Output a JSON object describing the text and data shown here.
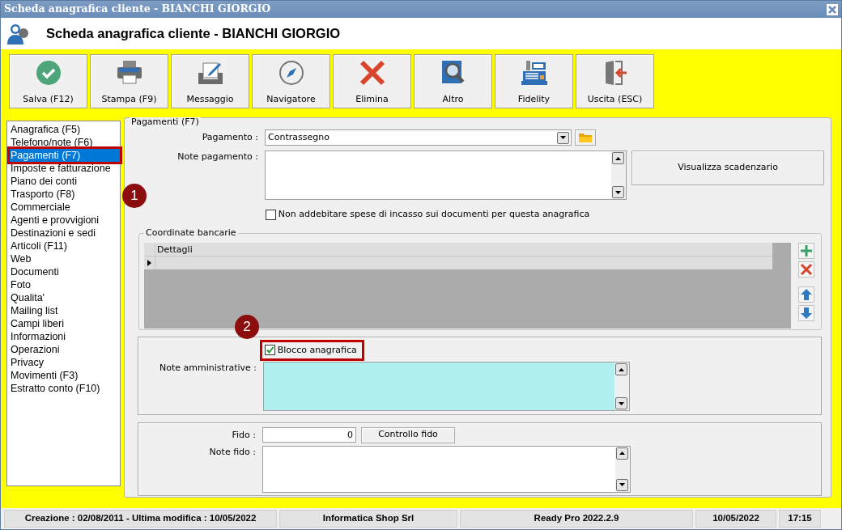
{
  "window": {
    "title": "Scheda anagrafica cliente - BIANCHI GIORGIO"
  },
  "header": {
    "title": "Scheda anagrafica cliente - BIANCHI GIORGIO"
  },
  "toolbar": [
    {
      "label": "Salva (F12)",
      "kind": "save"
    },
    {
      "label": "Stampa (F9)",
      "kind": "print"
    },
    {
      "label": "Messaggio",
      "kind": "message"
    },
    {
      "label": "Navigatore",
      "kind": "compass"
    },
    {
      "label": "Elimina",
      "kind": "delete"
    },
    {
      "label": "Altro",
      "kind": "search"
    },
    {
      "label": "Fidelity",
      "kind": "register"
    },
    {
      "label": "Uscita (ESC)",
      "kind": "exit"
    }
  ],
  "sidebar": {
    "items": [
      {
        "label": "Anagrafica (F5)",
        "selected": false
      },
      {
        "label": "Telefono/note (F6)",
        "selected": false
      },
      {
        "label": "Pagamenti (F7)",
        "selected": true
      },
      {
        "label": "Imposte e fatturazione",
        "selected": false
      },
      {
        "label": "Piano dei conti",
        "selected": false
      },
      {
        "label": "Trasporto (F8)",
        "selected": false
      },
      {
        "label": "Commerciale",
        "selected": false
      },
      {
        "label": "Agenti e provvigioni",
        "selected": false
      },
      {
        "label": "Destinazioni e sedi",
        "selected": false
      },
      {
        "label": "Articoli (F11)",
        "selected": false
      },
      {
        "label": "Web",
        "selected": false
      },
      {
        "label": "Documenti",
        "selected": false
      },
      {
        "label": "Foto",
        "selected": false
      },
      {
        "label": "Qualita'",
        "selected": false
      },
      {
        "label": "Mailing list",
        "selected": false
      },
      {
        "label": "Campi liberi",
        "selected": false
      },
      {
        "label": "Informazioni",
        "selected": false
      },
      {
        "label": "Operazioni",
        "selected": false
      },
      {
        "label": "Privacy",
        "selected": false
      },
      {
        "label": "Movimenti (F3)",
        "selected": false
      },
      {
        "label": "Estratto conto (F10)",
        "selected": false
      }
    ]
  },
  "payments": {
    "legend": "Pagamenti (F7)",
    "payment_label": "Pagamento :",
    "payment_value": "Contrassegno",
    "notes_label": "Note pagamento :",
    "schedule_button": "Visualizza scadenzario",
    "no_charge": {
      "label": "Non addebitare spese di incasso sui documenti per questa anagrafica",
      "checked": false
    }
  },
  "bank": {
    "legend": "Coordinate bancarie",
    "columns": [
      "Dettagli"
    ]
  },
  "admin": {
    "block": {
      "label": "Blocco anagrafica",
      "checked": true
    },
    "notes_label": "Note amministrative :"
  },
  "credit": {
    "fido_label": "Fido :",
    "fido_value": "0",
    "check_button": "Controllo fido",
    "notes_label": "Note fido :"
  },
  "status_bar": [
    "Creazione : 02/08/2011 - Ultima modifica : 10/05/2022",
    "Informatica Shop Srl",
    "Ready Pro 2022.2.9",
    "10/05/2022",
    "17:15"
  ],
  "callouts": [
    {
      "number": "1",
      "kind": "sidebar"
    },
    {
      "number": "2",
      "kind": "block"
    }
  ]
}
